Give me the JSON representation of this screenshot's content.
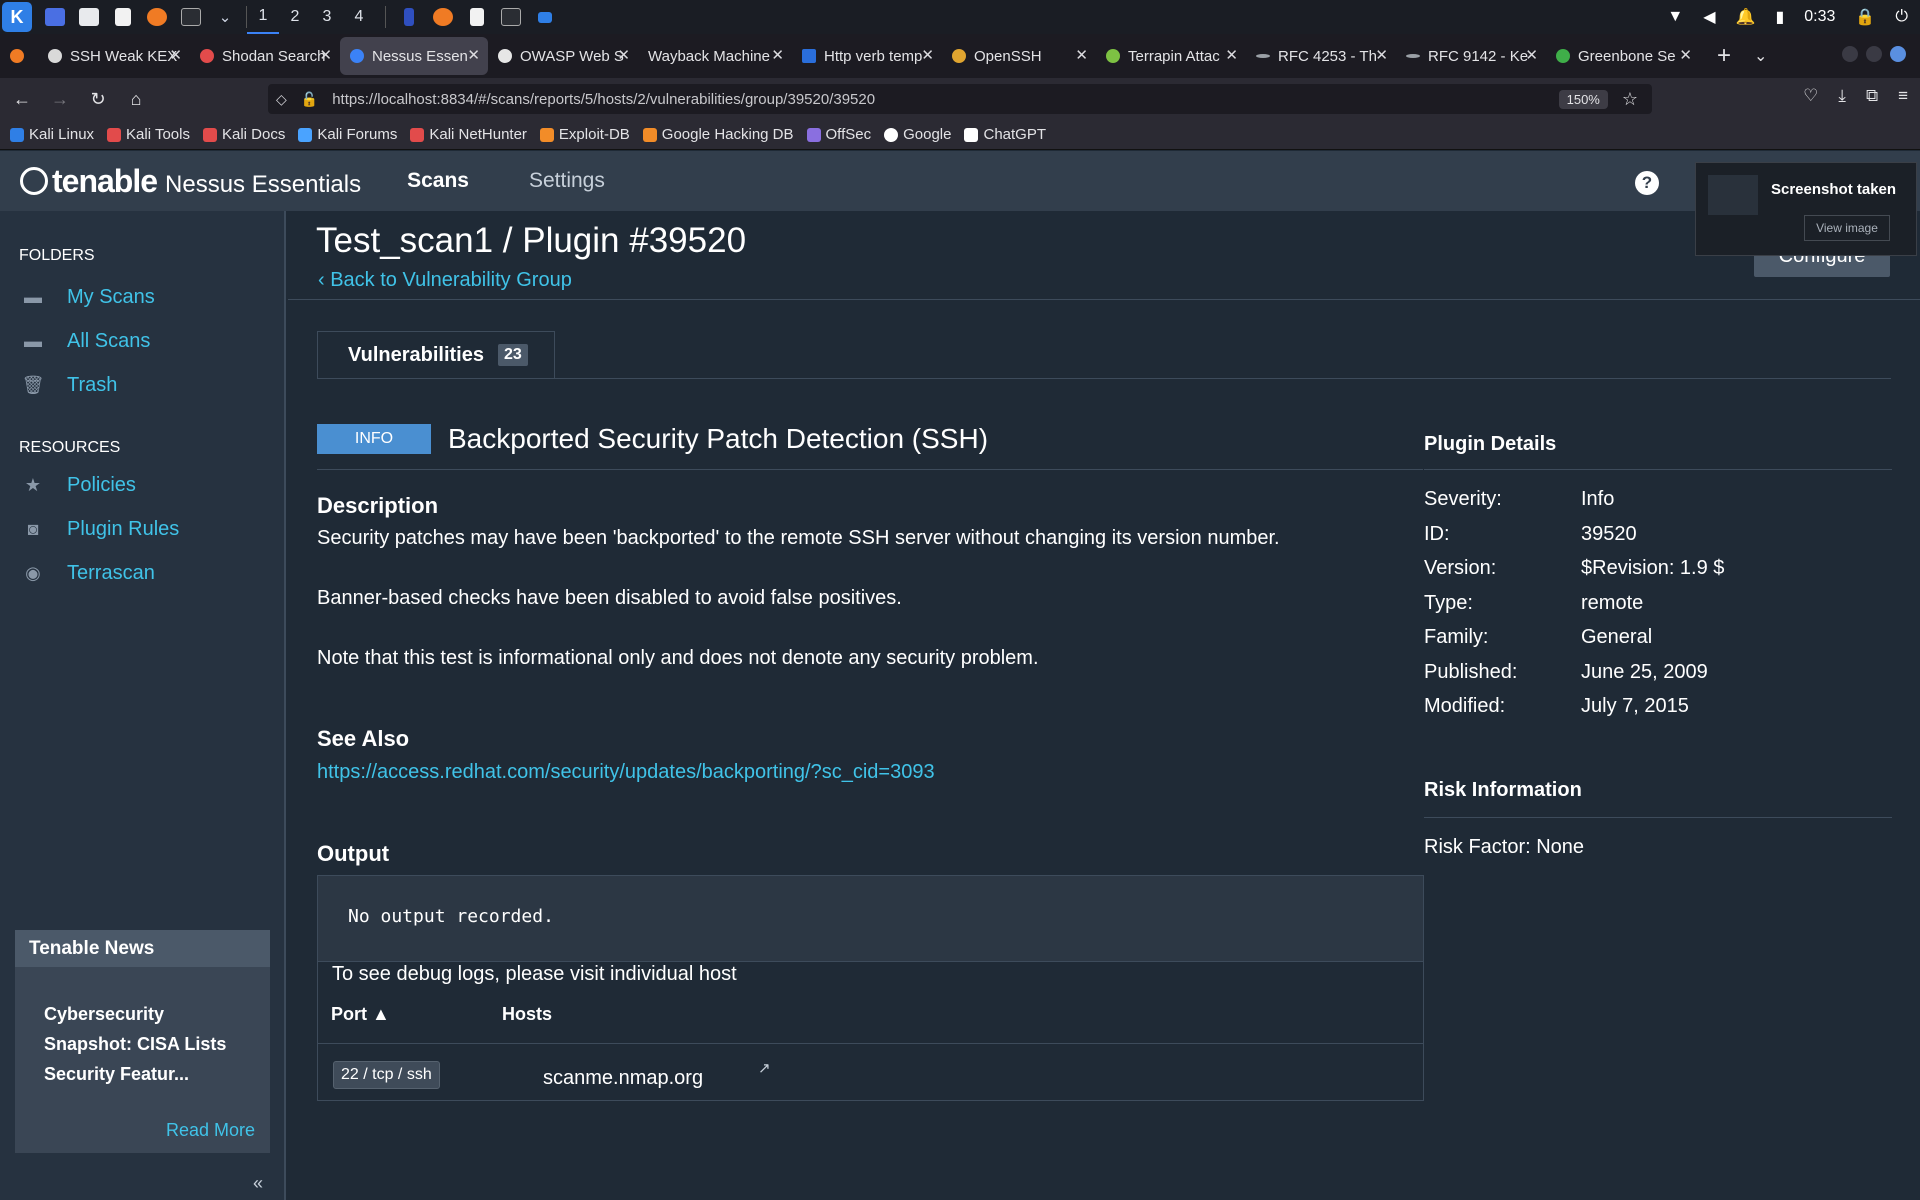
{
  "taskbar": {
    "workspaces": [
      "1",
      "2",
      "3",
      "4"
    ],
    "clock": "0:33"
  },
  "tabs": [
    {
      "label": "SSH Weak KEX",
      "color": "#d9d9d9"
    },
    {
      "label": "Shodan Search",
      "color": "#e24b4b"
    },
    {
      "label": "Nessus Essen",
      "color": "#3b82f6",
      "active": true
    },
    {
      "label": "OWASP Web S",
      "color": "#e6e6e6"
    },
    {
      "label": "Wayback Machine",
      "color": "#2b2a33"
    },
    {
      "label": "Http verb temp",
      "color": "#2a6edb"
    },
    {
      "label": "OpenSSH",
      "color": "#e0a530"
    },
    {
      "label": "Terrapin Attac",
      "color": "#7dc143"
    },
    {
      "label": "RFC 4253 - Th",
      "color": "#9aa0a6"
    },
    {
      "label": "RFC 9142 - Ke",
      "color": "#9aa0a6"
    },
    {
      "label": "Greenbone Se",
      "color": "#3fae49"
    }
  ],
  "url": {
    "full": "https://localhost:8834/#/scans/reports/5/hosts/2/vulnerabilities/group/39520/39520",
    "zoom": "150%"
  },
  "bookmarks": [
    {
      "label": "Kali Linux",
      "color": "#2f7fe6"
    },
    {
      "label": "Kali Tools",
      "color": "#e24b4b"
    },
    {
      "label": "Kali Docs",
      "color": "#e24b4b"
    },
    {
      "label": "Kali Forums",
      "color": "#4aa3ff"
    },
    {
      "label": "Kali NetHunter",
      "color": "#e24b4b"
    },
    {
      "label": "Exploit-DB",
      "color": "#f28c28"
    },
    {
      "label": "Google Hacking DB",
      "color": "#f28c28"
    },
    {
      "label": "OffSec",
      "color": "#8a6fe0"
    },
    {
      "label": "Google",
      "color": "#ffffff"
    },
    {
      "label": "ChatGPT",
      "color": "#ffffff"
    }
  ],
  "app": {
    "brand": "tenable",
    "product": "Nessus Essentials",
    "nav": [
      "Scans",
      "Settings"
    ]
  },
  "sidebar": {
    "folders_heading": "FOLDERS",
    "folders": [
      "My Scans",
      "All Scans",
      "Trash"
    ],
    "resources_heading": "RESOURCES",
    "resources": [
      "Policies",
      "Plugin Rules",
      "Terrascan"
    ],
    "news": {
      "heading": "Tenable News",
      "headline": "Cybersecurity Snapshot: CISA Lists Security Featur...",
      "read_more": "Read More"
    }
  },
  "page": {
    "title": "Test_scan1 / Plugin #39520",
    "back_link": "Back to Vulnerability Group",
    "tab_label": "Vulnerabilities",
    "tab_count": "23",
    "severity": "INFO",
    "plugin_name": "Backported Security Patch Detection (SSH)",
    "description_heading": "Description",
    "description": [
      "Security patches may have been 'backported' to the remote SSH server without changing its version number.",
      "Banner-based checks have been disabled to avoid false positives.",
      "Note that this test is informational only and does not denote any security problem."
    ],
    "see_also_heading": "See Also",
    "see_also_link": "https://access.redhat.com/security/updates/backporting/?sc_cid=3093",
    "output_heading": "Output",
    "output_text": "No output recorded.",
    "debug_note": "To see debug logs, please visit individual host",
    "table": {
      "port_header": "Port ▲",
      "hosts_header": "Hosts",
      "port": "22 / tcp / ssh",
      "host": "scanme.nmap.org"
    }
  },
  "plugin_details": {
    "heading": "Plugin Details",
    "rows": [
      {
        "key": "Severity:",
        "value": "Info"
      },
      {
        "key": "ID:",
        "value": "39520"
      },
      {
        "key": "Version:",
        "value": "$Revision: 1.9 $"
      },
      {
        "key": "Type:",
        "value": "remote"
      },
      {
        "key": "Family:",
        "value": "General"
      },
      {
        "key": "Published:",
        "value": "June 25, 2009"
      },
      {
        "key": "Modified:",
        "value": "July 7, 2015"
      }
    ],
    "risk_heading": "Risk Information",
    "risk_factor": "Risk Factor: None"
  },
  "popup": {
    "title": "Screenshot taken",
    "button": "View image",
    "configure": "Configure"
  },
  "colors": {
    "accent_link": "#40c3e8",
    "info_badge": "#4a8fd1",
    "header_bg": "#323e4c",
    "page_bg": "#1f2a36"
  }
}
